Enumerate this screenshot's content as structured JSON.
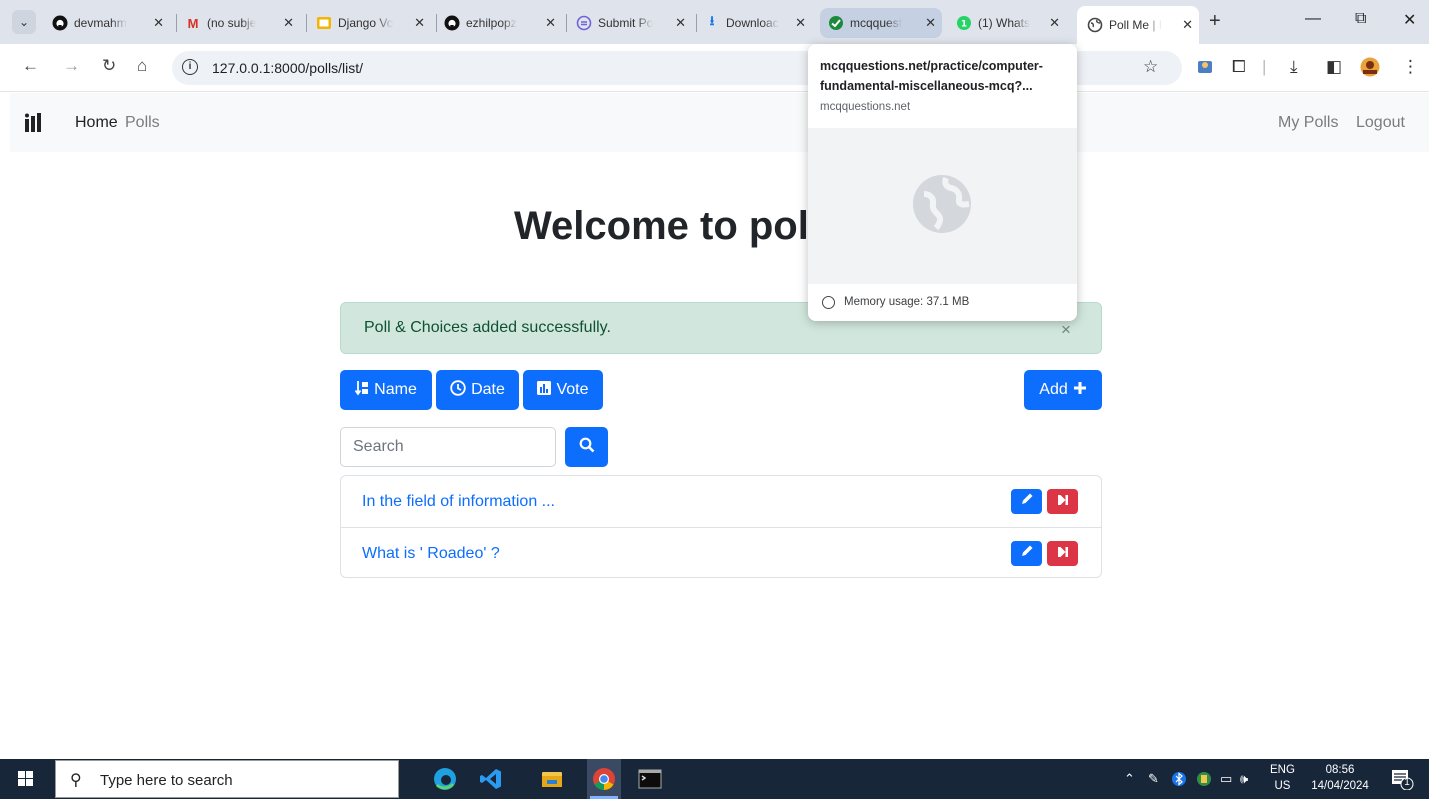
{
  "browser": {
    "tabs": [
      {
        "title": "devmahm",
        "icon": "github-icon"
      },
      {
        "title": "(no subje",
        "icon": "gmail-icon"
      },
      {
        "title": "Django Vo",
        "icon": "slides-icon"
      },
      {
        "title": "ezhilpopz",
        "icon": "github-icon"
      },
      {
        "title": "Submit Po",
        "icon": "submit-icon"
      },
      {
        "title": "Downloac",
        "icon": "download-icon"
      },
      {
        "title": "mcqquest",
        "icon": "mcq-icon"
      },
      {
        "title": "(1) Whats",
        "icon": "whatsapp-icon"
      },
      {
        "title": "Poll Me | I",
        "icon": "globe-icon"
      }
    ],
    "url": "127.0.0.1:8000/polls/list/",
    "hover_card": {
      "title": "mcqquestions.net/practice/computer-fundamental-miscellaneous-mcq?...",
      "domain": "mcqquestions.net",
      "memory": "Memory usage: 37.1 MB"
    }
  },
  "navbar": {
    "links_left": [
      "Home",
      "Polls"
    ],
    "links_right": [
      "My Polls",
      "Logout"
    ]
  },
  "page": {
    "heading": "Welcome to pol",
    "alert": "Poll & Choices added successfully.",
    "alert_close": "×",
    "sort_buttons": [
      "Name",
      "Date",
      "Vote"
    ],
    "add_button": "Add",
    "search_placeholder": "Search",
    "polls": [
      {
        "question": "In the field of information ..."
      },
      {
        "question": "What is ' Roadeo' ?"
      }
    ]
  },
  "taskbar": {
    "search_placeholder": "Type here to search",
    "language": "ENG",
    "region": "US",
    "time": "08:56",
    "date": "14/04/2024",
    "notification_count": "1"
  },
  "colors": {
    "primary": "#0d6efd",
    "danger": "#dc3545",
    "success_bg": "#d1e7dd",
    "success_text": "#0f5132",
    "navbar_bg": "#f8f9fa"
  }
}
